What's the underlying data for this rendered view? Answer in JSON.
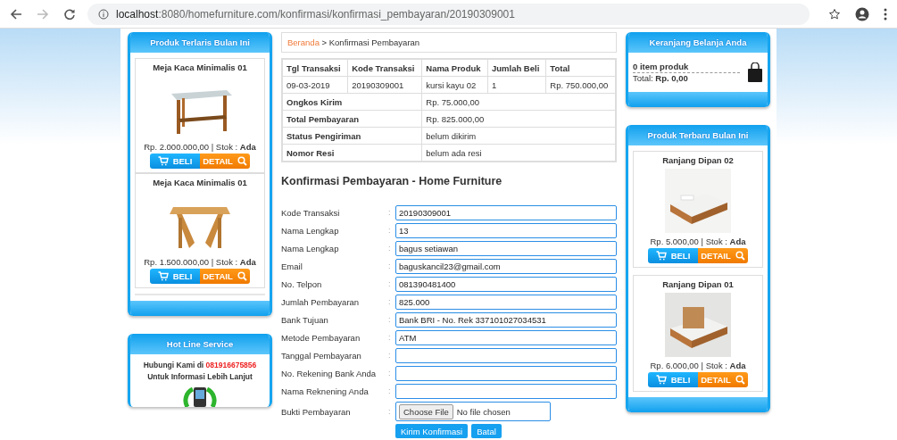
{
  "browser": {
    "url_host": "localhost",
    "url_rest": ":8080/homefurniture.com/konfirmasi/konfirmasi_pembayaran/20190309001"
  },
  "best_sellers": {
    "title": "Produk Terlaris Bulan Ini",
    "products": [
      {
        "name": "Meja Kaca Minimalis 01",
        "price": "Rp. 2.000.000,00 | Stok : **Ada**",
        "buy": "BELI",
        "detail": "DETAIL"
      },
      {
        "name": "Meja Kaca Minimalis 01",
        "price": "Rp. 1.500.000,00 | Stok : **Ada**",
        "buy": "BELI",
        "detail": "DETAIL"
      }
    ]
  },
  "hotline": {
    "title": "Hot Line Service",
    "text": "Hubungi Kami di",
    "phone": "081916675856",
    "line2": "Untuk Informasi Lebih Lanjut"
  },
  "breadcrumb": {
    "home": "Beranda",
    "current": "> Konfirmasi Pembayaran"
  },
  "order_table": {
    "columns": [
      "Tgl Transaksi",
      "Kode Transaksi",
      "Nama Produk",
      "Jumlah Beli",
      "Total"
    ],
    "row": [
      "09-03-2019",
      "20190309001",
      "kursi kayu 02",
      "1",
      "Rp. 750.000,00"
    ],
    "summary": [
      {
        "label": "Ongkos Kirim",
        "value": "Rp. 75.000,00"
      },
      {
        "label": "Total Pembayaran",
        "value": "Rp. 825.000,00"
      },
      {
        "label": "Status Pengiriman",
        "value": "belum dikirim"
      },
      {
        "label": "Nomor Resi",
        "value": "belum ada resi"
      }
    ]
  },
  "form": {
    "heading": "Konfirmasi Pembayaran - Home Furniture",
    "separator": ":",
    "fields": [
      {
        "label": "Kode Transaksi",
        "kind": "text",
        "value": "20190309001"
      },
      {
        "label": "Nama Lengkap",
        "kind": "text",
        "value": "13"
      },
      {
        "label": "Nama Lengkap",
        "kind": "text",
        "value": "bagus setiawan"
      },
      {
        "label": "Email",
        "kind": "text",
        "value": "baguskancil23@gmail.com"
      },
      {
        "label": "No. Telpon",
        "kind": "text",
        "value": "081390481400"
      },
      {
        "label": "Jumlah Pembayaran",
        "kind": "text",
        "value": "825.000"
      },
      {
        "label": "Bank Tujuan",
        "kind": "text",
        "value": "Bank BRI - No. Rek 337101027034531"
      },
      {
        "label": "Metode Pembayaran",
        "kind": "text",
        "value": "ATM"
      },
      {
        "label": "Tanggal Pembayaran",
        "kind": "text"
      },
      {
        "label": "No. Rekening Bank Anda",
        "kind": "text"
      },
      {
        "label": "Nama Reknening Anda",
        "kind": "text"
      },
      {
        "label": "Bukti Pembayaran",
        "kind": "file",
        "button": "Choose File",
        "status": "No file chosen"
      }
    ],
    "buttons": [
      "Kirim Konfirmasi",
      "Batal"
    ]
  },
  "cart": {
    "title": "Keranjang Belanja Anda",
    "items": "0 item produk",
    "total": "Total: **Rp. 0,00**"
  },
  "new_products": {
    "title": "Produk Terbaru Bulan Ini",
    "products": [
      {
        "name": "Ranjang Dipan 02",
        "price": "Rp. 5.000,00 | Stok : **Ada**",
        "buy": "BELI",
        "detail": "DETAIL"
      },
      {
        "name": "Ranjang Dipan 01",
        "price": "Rp. 6.000,00 | Stok : **Ada**",
        "buy": "BELI",
        "detail": "DETAIL"
      }
    ]
  }
}
